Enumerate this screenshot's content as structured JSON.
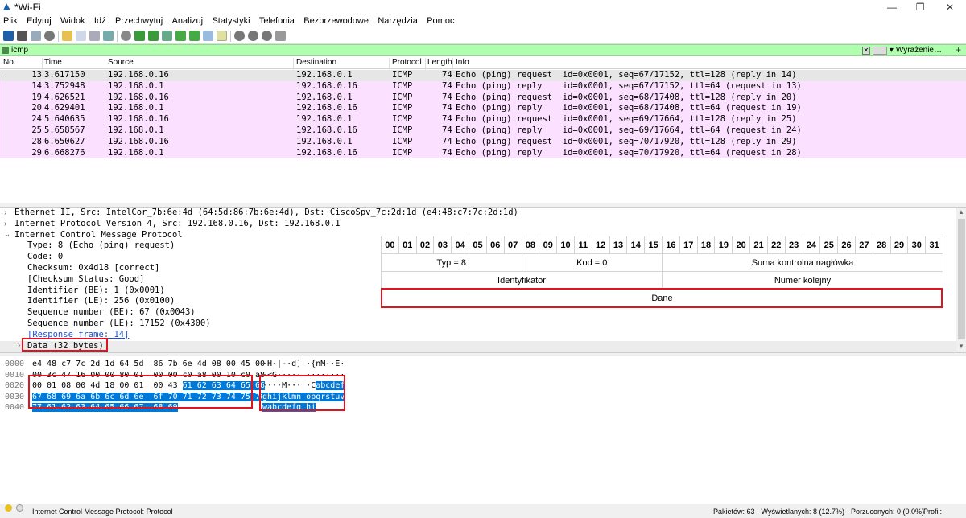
{
  "window": {
    "title": "*Wi-Fi"
  },
  "menu": [
    "Plik",
    "Edytuj",
    "Widok",
    "Idź",
    "Przechwytuj",
    "Analizuj",
    "Statystyki",
    "Telefonia",
    "Bezprzewodowe",
    "Narzędzia",
    "Pomoc"
  ],
  "filter": {
    "value": "icmp",
    "expressions_label": "Wyrażenie…",
    "plus": "+"
  },
  "packet_list": {
    "columns": [
      "No.",
      "Time",
      "Source",
      "Destination",
      "Protocol",
      "Length",
      "Info"
    ],
    "rows": [
      {
        "no": "13",
        "time": "3.617150",
        "src": "192.168.0.16",
        "dst": "192.168.0.1",
        "proto": "ICMP",
        "len": "74",
        "info": "Echo (ping) request  id=0x0001, seq=67/17152, ttl=128 (reply in 14)"
      },
      {
        "no": "14",
        "time": "3.752948",
        "src": "192.168.0.1",
        "dst": "192.168.0.16",
        "proto": "ICMP",
        "len": "74",
        "info": "Echo (ping) reply    id=0x0001, seq=67/17152, ttl=64 (request in 13)"
      },
      {
        "no": "19",
        "time": "4.626521",
        "src": "192.168.0.16",
        "dst": "192.168.0.1",
        "proto": "ICMP",
        "len": "74",
        "info": "Echo (ping) request  id=0x0001, seq=68/17408, ttl=128 (reply in 20)"
      },
      {
        "no": "20",
        "time": "4.629401",
        "src": "192.168.0.1",
        "dst": "192.168.0.16",
        "proto": "ICMP",
        "len": "74",
        "info": "Echo (ping) reply    id=0x0001, seq=68/17408, ttl=64 (request in 19)"
      },
      {
        "no": "24",
        "time": "5.640635",
        "src": "192.168.0.16",
        "dst": "192.168.0.1",
        "proto": "ICMP",
        "len": "74",
        "info": "Echo (ping) request  id=0x0001, seq=69/17664, ttl=128 (reply in 25)"
      },
      {
        "no": "25",
        "time": "5.658567",
        "src": "192.168.0.1",
        "dst": "192.168.0.16",
        "proto": "ICMP",
        "len": "74",
        "info": "Echo (ping) reply    id=0x0001, seq=69/17664, ttl=64 (request in 24)"
      },
      {
        "no": "28",
        "time": "6.650627",
        "src": "192.168.0.16",
        "dst": "192.168.0.1",
        "proto": "ICMP",
        "len": "74",
        "info": "Echo (ping) request  id=0x0001, seq=70/17920, ttl=128 (reply in 29)"
      },
      {
        "no": "29",
        "time": "6.668276",
        "src": "192.168.0.1",
        "dst": "192.168.0.16",
        "proto": "ICMP",
        "len": "74",
        "info": "Echo (ping) reply    id=0x0001, seq=70/17920, ttl=64 (request in 28)"
      }
    ]
  },
  "details": {
    "ethernet": "Ethernet II, Src: IntelCor_7b:6e:4d (64:5d:86:7b:6e:4d), Dst: CiscoSpv_7c:2d:1d (e4:48:c7:7c:2d:1d)",
    "ip": "Internet Protocol Version 4, Src: 192.168.0.16, Dst: 192.168.0.1",
    "icmp": "Internet Control Message Protocol",
    "fields": [
      "Type: 8 (Echo (ping) request)",
      "Code: 0",
      "Checksum: 0x4d18 [correct]",
      "[Checksum Status: Good]",
      "Identifier (BE): 1 (0x0001)",
      "Identifier (LE): 256 (0x0100)",
      "Sequence number (BE): 67 (0x0043)",
      "Sequence number (LE): 17152 (0x4300)"
    ],
    "response_frame": "[Response frame: 14]",
    "data": "Data (32 bytes)"
  },
  "icmp_table": {
    "bits": [
      "00",
      "01",
      "02",
      "03",
      "04",
      "05",
      "06",
      "07",
      "08",
      "09",
      "10",
      "11",
      "12",
      "13",
      "14",
      "15",
      "16",
      "17",
      "18",
      "19",
      "20",
      "21",
      "22",
      "23",
      "24",
      "25",
      "26",
      "27",
      "28",
      "29",
      "30",
      "31"
    ],
    "type": "Typ = 8",
    "code": "Kod = 0",
    "checksum": "Suma kontrolna nagłówka",
    "identifier": "Identyfikator",
    "sequence": "Numer kolejny",
    "data": "Dane"
  },
  "hex": {
    "rows": [
      {
        "off": "0000",
        "bytes_pre": "e4 48 c7 7c 2d 1d 64 5d  86 7b 6e 4d 08 00 45 00",
        "bytes_hl": "",
        "ascii_pre": "·H·|-·d] ·{nM··E·",
        "ascii_hl": ""
      },
      {
        "off": "0010",
        "bytes_pre": "00 3c 47 16 00 00 80 01  00 00 c0 a8 00 10 c0 a8",
        "bytes_hl": "",
        "ascii_pre": "·<G····· ········",
        "ascii_hl": ""
      },
      {
        "off": "0020",
        "bytes_pre": "00 01 08 00 4d 18 00 01  00 43 ",
        "bytes_hl": "61 62 63 64 65 66",
        "ascii_pre": "····M··· ·C",
        "ascii_hl": "abcdef"
      },
      {
        "off": "0030",
        "bytes_pre": "",
        "bytes_hl": "67 68 69 6a 6b 6c 6d 6e  6f 70 71 72 73 74 75 76",
        "ascii_pre": "",
        "ascii_hl": "ghijklmn opqrstuv"
      },
      {
        "off": "0040",
        "bytes_pre": "",
        "bytes_hl": "77 61 62 63 64 65 66 67  68 69",
        "ascii_pre": "",
        "ascii_hl": "wabcdefg hi"
      }
    ]
  },
  "status": {
    "text": "Internet Control Message Protocol: Protocol",
    "packets": "Pakietów: 63 · Wyświetlanych: 8 (12.7%) · Porzuconych: 0 (0.0%)",
    "profile": "Profil: Default"
  }
}
